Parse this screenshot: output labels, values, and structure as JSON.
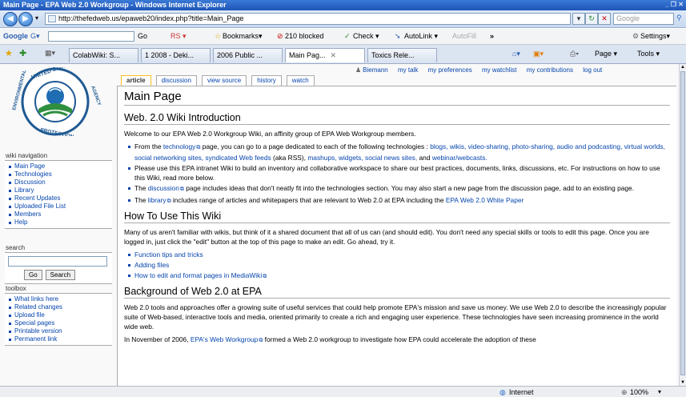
{
  "window": {
    "title": "Main Page - EPA Web 2.0 Workgroup - Windows Internet Explorer",
    "controls": "_ ❐ ✕"
  },
  "address": {
    "url": "http://thefedweb.us/epaweb20/index.php?title=Main_Page",
    "search_placeholder": "Google"
  },
  "google_toolbar": {
    "logo": "Google",
    "g_button": "G▾",
    "go": "Go",
    "rs": "RS ▾",
    "bookmarks": "Bookmarks▾",
    "blocked": "210 blocked",
    "check": "Check ▾",
    "autolink": "AutoLink ▾",
    "autofill": "AutoFill",
    "more": "»",
    "settings": "Settings▾"
  },
  "browser_tabs": [
    {
      "label": "ColabWiki: S..."
    },
    {
      "label": "1 2008 - Deki..."
    },
    {
      "label": "2006 Public ..."
    },
    {
      "label": "Main Pag..."
    },
    {
      "label": "Toxics Rele..."
    }
  ],
  "browser_tools": {
    "page": "Page ▾",
    "tools": "Tools ▾"
  },
  "personal": {
    "user": "Biemann",
    "links": [
      "my talk",
      "my preferences",
      "my watchlist",
      "my contributions",
      "log out"
    ]
  },
  "page_tabs": [
    "article",
    "discussion",
    "view source",
    "history",
    "watch"
  ],
  "sidebar": {
    "navigation_title": "wiki navigation",
    "navigation": [
      "Main Page",
      "Technologies",
      "Discussion",
      "Library",
      "Recent Updates",
      "Uploaded File List",
      "Members",
      "Help"
    ],
    "search_title": "search",
    "go_label": "Go",
    "search_label": "Search",
    "toolbox_title": "toolbox",
    "toolbox": [
      "What links here",
      "Related changes",
      "Upload file",
      "Special pages",
      "Printable version",
      "Permanent link"
    ]
  },
  "content": {
    "page_title": "Main Page",
    "intro_heading": "Web. 2.0 Wiki Introduction",
    "welcome": "Welcome to our EPA Web 2.0 Workgroup Wiki, an affinity group of EPA Web Workgroup members.",
    "b1_pre": "From the",
    "b1_link": "technology",
    "b1_mid": "page, you can go to a page dedicated to each of the following technologies :",
    "b1_techs": "blogs, wikis, video-sharing, photo-sharing, audio and podcasting, virtual worlds, social networking sites, syndicated Web feeds",
    "b1_rss": "(aka RSS),",
    "b1_techs2": "mashups, widgets, social news sites,",
    "b1_and": "and",
    "b1_last": "webinar/webcasts.",
    "b2": "Please use this EPA intranet Wiki to build an inventory and collaborative workspace to share our best practices, documents, links, discussions, etc. For instructions on how to use this Wiki, read more below.",
    "b3_pre": "The",
    "b3_link": "discussion",
    "b3_post": "page includes ideas that don't neatly fit into the technologies section. You may also start a new page from the discussion page, add to an existing page.",
    "b4_pre": "The",
    "b4_link": "library",
    "b4_post": "includes range of articles and whitepapers that are relevant to Web 2.0 at EPA including the",
    "b4_link2": "EPA Web 2.0 White Paper",
    "howto_heading": "How To Use This Wiki",
    "howto_p": "Many of us aren't familiar with wikis, but think of it a shared document that all of us can (and should edit). You don't need any special skills or tools to edit this page. Once you are logged in, just click the \"edit\" button at the top of this page to make an edit. Go ahead, try it.",
    "howto_links": [
      "Function tips and tricks",
      "Adding files",
      "How to edit and format pages in MediaWiki"
    ],
    "background_heading": "Background of Web 2.0 at EPA",
    "background_p": "Web 2.0 tools and approaches offer a growing suite of useful services that could help promote EPA's mission and save us money. We use Web 2.0 to describe the increasingly popular suite of Web-based, interactive tools and media, oriented primarily to create a rich and engaging user experience. These technologies have seen increasing prominence in the world wide web.",
    "cut_pre": "In November of 2006,",
    "cut_link": "EPA's Web Workgroup",
    "cut_post": "formed a Web 2.0 workgroup to investigate how EPA could accelerate the adoption of these"
  },
  "status": {
    "zone": "Internet",
    "zoom": "100%"
  }
}
